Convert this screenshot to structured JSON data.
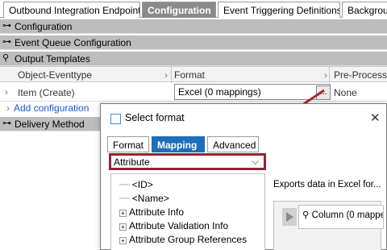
{
  "tabs": [
    {
      "label": "Outbound Integration Endpoint",
      "active": false
    },
    {
      "label": "Configuration",
      "active": true
    },
    {
      "label": "Event Triggering Definitions",
      "active": false
    },
    {
      "label": "Backgrou",
      "active": false
    }
  ],
  "sections": {
    "configuration": "Configuration",
    "event_queue": "Event Queue Configuration",
    "output_templates": "Output Templates",
    "delivery_method": "Delivery Method"
  },
  "grid": {
    "columns": [
      "Object-Eventtype",
      "Format",
      "Pre-Processor"
    ],
    "row": {
      "object": "Item (Create)",
      "format": "Excel (0 mappings)",
      "browse": "...",
      "preprocessor": "None"
    },
    "add_configuration": "Add configuration"
  },
  "dialog": {
    "title": "Select format",
    "close": "✕",
    "tabs": [
      {
        "label": "Format",
        "active": false
      },
      {
        "label": "Mapping",
        "active": true
      },
      {
        "label": "Advanced",
        "active": false
      }
    ],
    "dropdown_value": "Attribute",
    "tree": [
      {
        "label": "<ID>",
        "expandable": false
      },
      {
        "label": "<Name>",
        "expandable": false
      },
      {
        "label": "Attribute Info",
        "expandable": true
      },
      {
        "label": "Attribute Validation Info",
        "expandable": true
      },
      {
        "label": "Attribute Group References",
        "expandable": true
      }
    ],
    "description": "Exports data in Excel for...",
    "column_item": "Column (0 mappe"
  },
  "colors": {
    "accent_tab": "#1e6fb8",
    "highlight_border": "#8b2a31",
    "arrow": "#a52a2a",
    "link": "#1a56d6"
  }
}
